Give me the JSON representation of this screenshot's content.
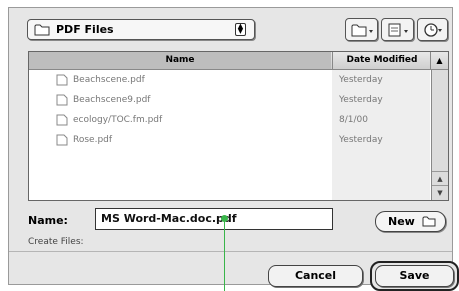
{
  "file_type_popup": {
    "label": "PDF Files"
  },
  "toolbar": {
    "icons": [
      "folder-shortcut-icon",
      "document-shortcut-icon",
      "recent-clock-icon"
    ]
  },
  "file_list": {
    "columns": {
      "name": "Name",
      "date": "Date Modified",
      "sort_indicator": "▲"
    },
    "rows": [
      {
        "name": "Beachscene.pdf",
        "date": "Yesterday"
      },
      {
        "name": "Beachscene9.pdf",
        "date": "Yesterday"
      },
      {
        "name": "ecology/TOC.fm.pdf",
        "date": "8/1/00"
      },
      {
        "name": "Rose.pdf",
        "date": "Yesterday"
      }
    ]
  },
  "name_field": {
    "label": "Name:",
    "value": "MS Word-Mac.doc.pdf"
  },
  "new_button": {
    "label": "New"
  },
  "create_files": {
    "label": "Create Files:"
  },
  "buttons": {
    "cancel": "Cancel",
    "save": "Save"
  },
  "colors": {
    "accent": "#39b54a",
    "dialog_bg": "#e6e6e6"
  }
}
